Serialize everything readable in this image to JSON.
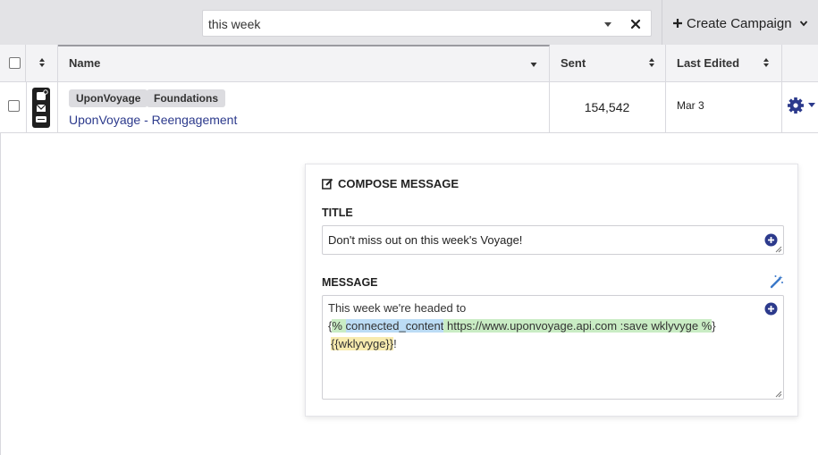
{
  "search": {
    "value": "this week"
  },
  "toolbar": {
    "create_label": "Create Campaign"
  },
  "table": {
    "headers": {
      "name": "Name",
      "sent": "Sent",
      "last_edited": "Last Edited"
    },
    "rows": [
      {
        "tags": [
          "UponVoyage",
          "Foundations"
        ],
        "name": "UponVoyage - Reengagement",
        "sent": "154,542",
        "last_edited": "Mar 3"
      }
    ]
  },
  "compose": {
    "heading": "COMPOSE MESSAGE",
    "title_label": "TITLE",
    "title_value": "Don't miss out on this week's Voyage!",
    "message_label": "MESSAGE",
    "message": {
      "line1": "This week we're headed to",
      "brace_open": "{",
      "tag_open": "% ",
      "connected": "connected_content",
      "url_part": " https://www.uponvoyage.api.com :save wklyvyge %",
      "brace_close": "}",
      "var": "{{wklyvyge}}",
      "end": "!"
    }
  },
  "colors": {
    "accent": "#2c3a8c",
    "link": "#2c3a8c"
  },
  "icons": {
    "search_caret": "caret-down-icon",
    "search_clear": "close-icon",
    "create_plus": "plus-icon",
    "create_chevron": "chevron-down-icon",
    "channel": "multichannel-icon",
    "settings": "gear-icon",
    "compose": "edit-icon",
    "add": "plus-circle-icon",
    "magic": "magic-wand-icon"
  }
}
